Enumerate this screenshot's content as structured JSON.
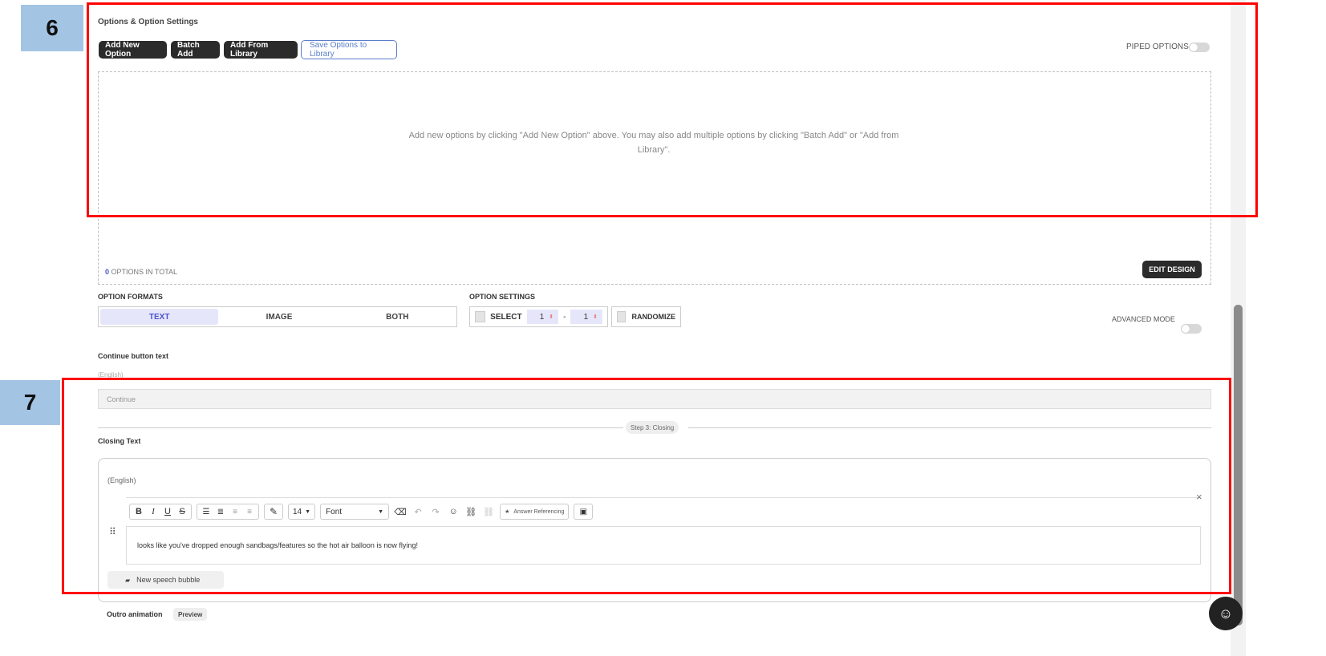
{
  "markers": {
    "six": "6",
    "seven": "7"
  },
  "options_section": {
    "title": "Options & Option Settings",
    "buttons": {
      "add_new_option": "Add New Option",
      "batch_add": "Batch Add",
      "add_from_library": "Add From Library",
      "save_to_library": "Save Options to Library"
    },
    "piped_options_label": "PIPED OPTIONS",
    "empty_message_line1": "Add new options by clicking \"Add New Option\" above. You may also add multiple options by clicking \"Batch Add\" or \"Add from",
    "empty_message_line2": "Library\".",
    "options_count": "0",
    "options_total_label": "OPTIONS IN TOTAL",
    "edit_design": "EDIT DESIGN"
  },
  "option_formats": {
    "label": "OPTION FORMATS",
    "items": [
      "TEXT",
      "IMAGE",
      "BOTH"
    ],
    "selected": "TEXT"
  },
  "option_settings": {
    "label": "OPTION SETTINGS",
    "select_label": "SELECT",
    "min_value": "1",
    "separator": "-",
    "max_value": "1",
    "randomize_label": "RANDOMIZE"
  },
  "advanced_mode_label": "ADVANCED MODE",
  "continue_button": {
    "label": "Continue button text",
    "language": "(English)",
    "placeholder": "Continue"
  },
  "step_divider": "Step 3: Closing",
  "closing": {
    "label": "Closing Text",
    "language": "(English)",
    "toolbar": {
      "font_size": "14",
      "font_name": "Font",
      "answer_referencing": "Answer Referencing"
    },
    "bubble_text": "looks like you've dropped enough sandbags/features so the hot air balloon is now flying!",
    "new_bubble": "New speech bubble"
  },
  "outro": {
    "label": "Outro animation",
    "preview": "Preview"
  },
  "colors": {
    "accent": "#4a55c9",
    "marker_bg": "#a4c4e4",
    "highlight_border": "#ff0000",
    "dark_button": "#2b2b2b"
  }
}
